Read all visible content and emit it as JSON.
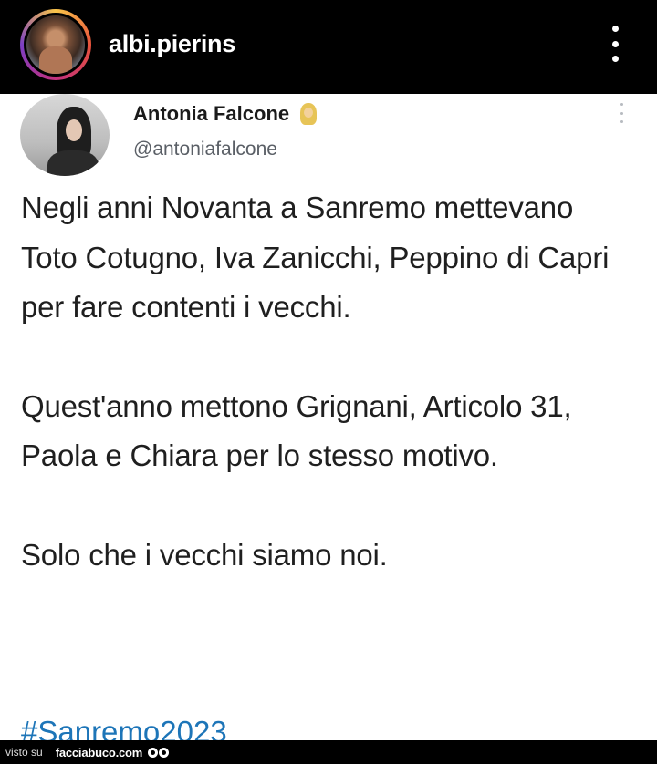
{
  "header": {
    "username": "albi.pierins",
    "avatar_icon": "profile-photo",
    "menu_icon": "more-vertical-icon"
  },
  "tweet": {
    "display_name": "Antonia Falcone",
    "emoji_icon": "blonde-woman-emoji",
    "handle": "@antoniafalcone",
    "paragraphs": [
      "Negli anni Novanta a Sanremo mettevano Toto Cotugno, Iva Zanicchi, Peppino di Capri per fare contenti i vecchi.",
      "Quest'anno mettono Grignani, Articolo 31, Paola e Chiara per lo stesso motivo.",
      "Solo che i vecchi siamo noi."
    ],
    "hashtag": "#Sanremo2023"
  },
  "footer": {
    "prefix": "visto su",
    "site": "facciabuco.com"
  },
  "colors": {
    "background": "#000000",
    "card": "#ffffff",
    "hashtag": "#1d75b8",
    "text": "#1f1f1f",
    "handle": "#5a5f66"
  }
}
